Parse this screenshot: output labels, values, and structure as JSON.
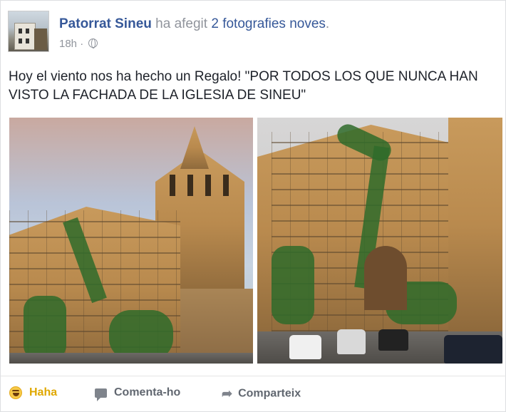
{
  "post": {
    "author": "Patorrat Sineu",
    "action_prefix": "ha afegit",
    "action_link": "2 fotografies noves",
    "action_suffix": ".",
    "timestamp": "18h",
    "separator": "·",
    "visibility_icon": "globe-icon",
    "text": "Hoy el viento nos ha hecho un Regalo! \"POR TODOS LOS QUE NUNCA HAN VISTO LA FACHADA DE LA IGLESIA DE SINEU\""
  },
  "actions": {
    "haha": "Haha",
    "comment": "Comenta-ho",
    "share": "Comparteix",
    "share_glyph": "➦"
  },
  "colors": {
    "link": "#365899",
    "meta": "#90949c",
    "text": "#1d2129",
    "haha": "#e0a800"
  }
}
